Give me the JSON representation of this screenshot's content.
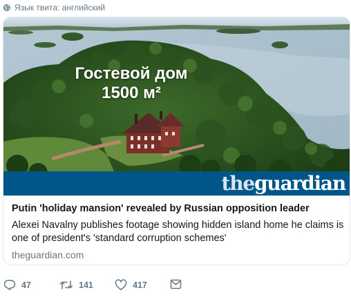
{
  "language_note": {
    "icon": "globe-icon",
    "text": "Язык твита: английский"
  },
  "card": {
    "image_overlay": {
      "line1": "Гостевой дом",
      "line2": "1500 м²"
    },
    "brand": {
      "prefix": "the",
      "name": "guardian",
      "color": "#005689"
    },
    "title": "Putin 'holiday mansion' revealed by Russian opposition leader",
    "description": "Alexei Navalny publishes footage showing hidden island home he claims is one of president's 'standard corruption schemes'",
    "domain": "theguardian.com"
  },
  "actions": {
    "reply": {
      "icon": "reply-icon",
      "count": "47"
    },
    "retweet": {
      "icon": "retweet-icon",
      "count": "141"
    },
    "like": {
      "icon": "heart-icon",
      "count": "417"
    },
    "message": {
      "icon": "envelope-icon"
    }
  }
}
